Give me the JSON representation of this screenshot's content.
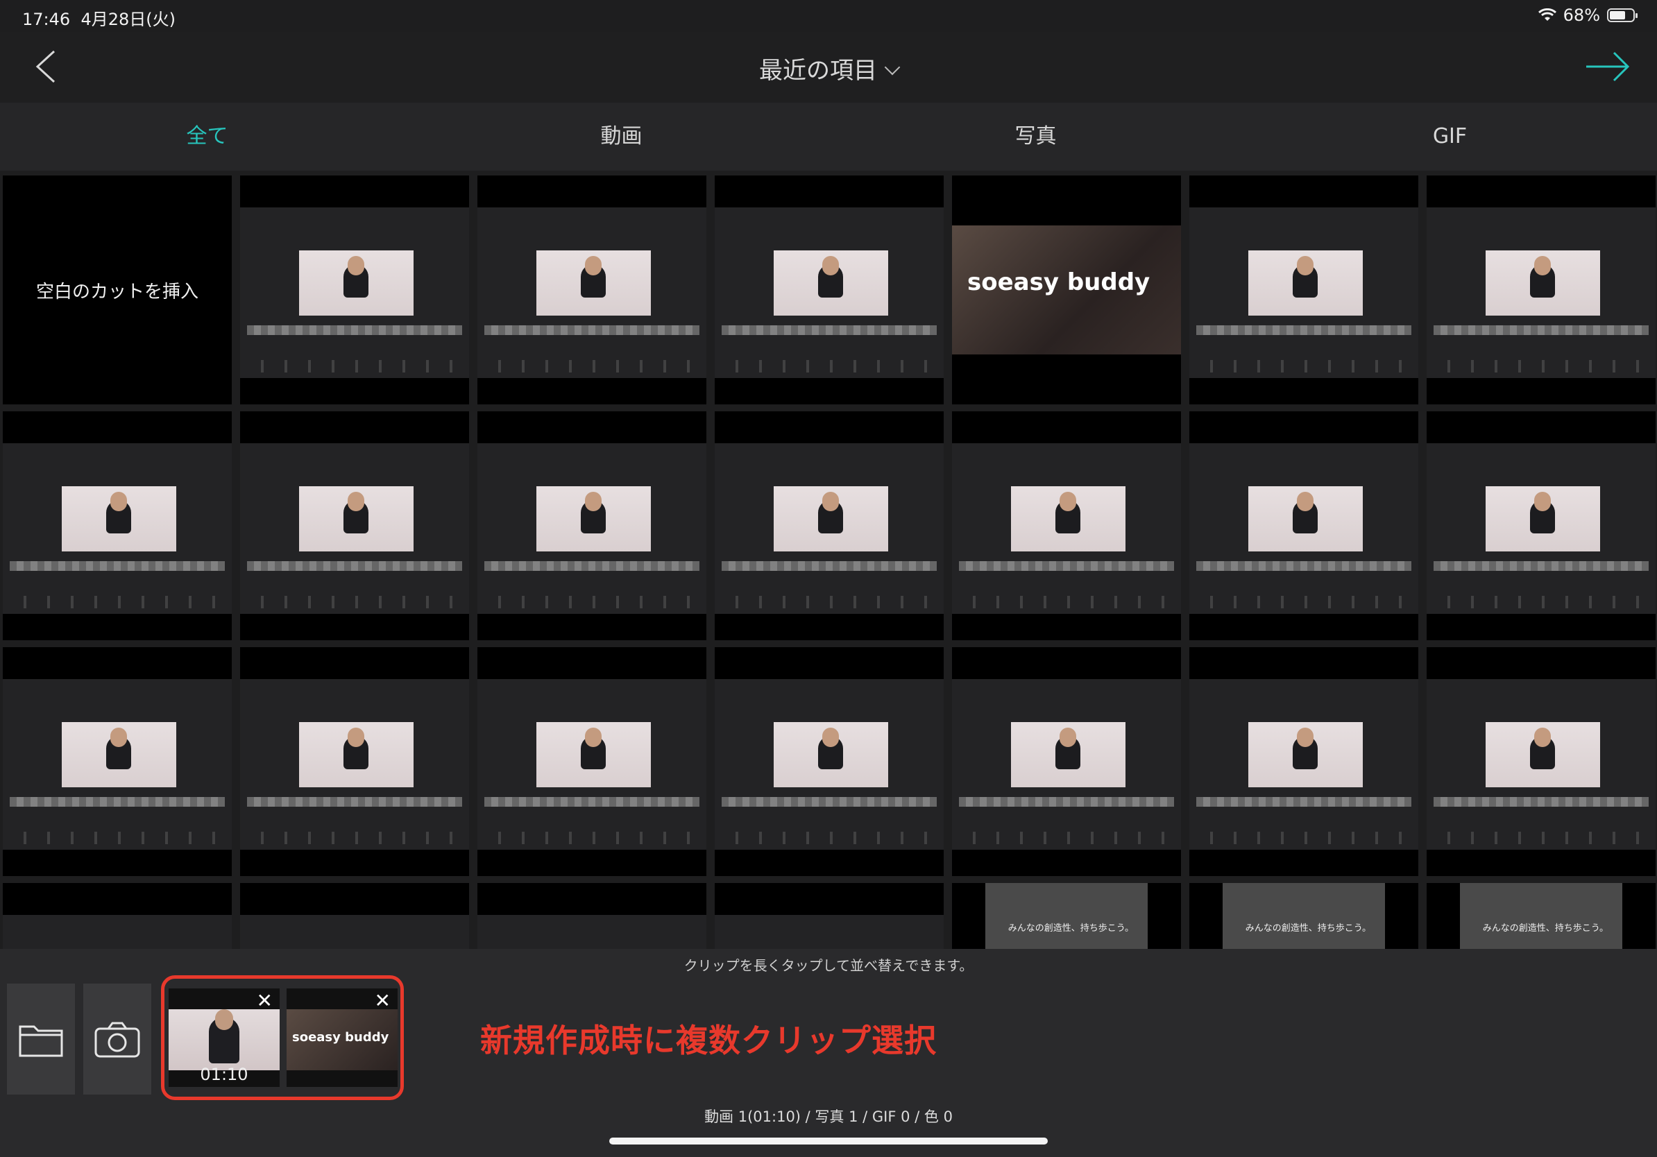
{
  "status_bar": {
    "time": "17:46",
    "date": "4月28日(火)",
    "battery": "68%",
    "battery_level": 0.68
  },
  "header": {
    "title": "最近の項目",
    "back_icon": "chevron-left-icon",
    "next_icon": "arrow-right-icon",
    "accent_color": "#27c5bd"
  },
  "tabs": [
    {
      "label": "全て",
      "active": true
    },
    {
      "label": "動画",
      "active": false
    },
    {
      "label": "写真",
      "active": false
    },
    {
      "label": "GIF",
      "active": false
    }
  ],
  "grid": {
    "insert_label": "空白のカットを挿入",
    "photo_logo": "soeasy buddy",
    "promo_text": "みんなの創造性、持ち歩こう。"
  },
  "bottom": {
    "hint": "クリップを長くタップして並べ替えできます。",
    "selected_clips": [
      {
        "type": "video",
        "duration": "01:10"
      },
      {
        "type": "photo",
        "logo": "soeasy buddy"
      }
    ],
    "annotation": "新規作成時に複数クリップ選択",
    "summary": "動画 1(01:10) / 写真 1 / GIF 0 / 色 0",
    "highlight_color": "#e8392c"
  }
}
